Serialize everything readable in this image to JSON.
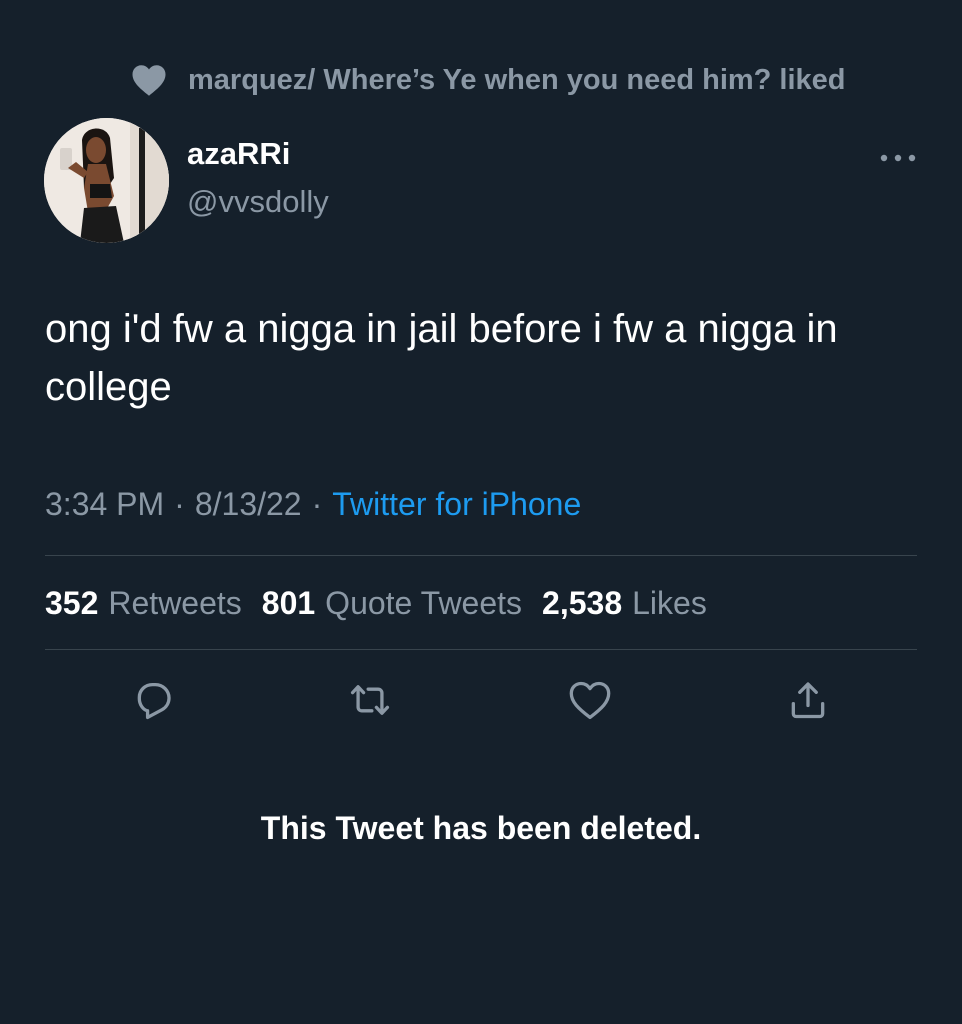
{
  "context": {
    "text": "marquez/ Where’s Ye when you need him? liked",
    "icon": "heart-filled-icon"
  },
  "author": {
    "display_name": "azaRRi",
    "handle": "@vvsdolly"
  },
  "tweet": {
    "text": "ong i'd fw a nigga in jail before i fw a nigga in college",
    "time": "3:34 PM",
    "date": "8/13/22",
    "separator": "·",
    "source": "Twitter for iPhone"
  },
  "stats": [
    {
      "count": "352",
      "label": "Retweets"
    },
    {
      "count": "801",
      "label": "Quote Tweets"
    },
    {
      "count": "2,538",
      "label": "Likes"
    }
  ],
  "actions": [
    "reply-icon",
    "retweet-icon",
    "like-icon",
    "share-icon"
  ],
  "notice": "This Tweet has been deleted.",
  "colors": {
    "background": "#15202b",
    "secondary_text": "#8b98a5",
    "link": "#1d9bf0",
    "divider": "#38444d"
  }
}
